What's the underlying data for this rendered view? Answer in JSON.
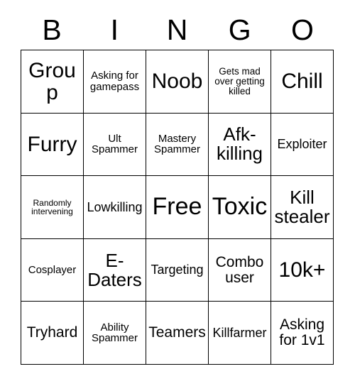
{
  "header": {
    "letters": [
      "B",
      "I",
      "N",
      "G",
      "O"
    ]
  },
  "grid": {
    "rows": [
      [
        {
          "text": "Group",
          "size": "fs-xl"
        },
        {
          "text": "Asking for gamepass",
          "size": "fs-xs"
        },
        {
          "text": "Noob",
          "size": "fs-xl"
        },
        {
          "text": "Gets mad over getting killed",
          "size": "fs-xxs"
        },
        {
          "text": "Chill",
          "size": "fs-xl"
        }
      ],
      [
        {
          "text": "Furry",
          "size": "fs-xl"
        },
        {
          "text": "Ult Spammer",
          "size": "fs-xs"
        },
        {
          "text": "Mastery Spammer",
          "size": "fs-xs"
        },
        {
          "text": "Afk-killing",
          "size": "fs-lg"
        },
        {
          "text": "Exploiter",
          "size": "fs-sm"
        }
      ],
      [
        {
          "text": "Randomly intervening",
          "size": "fs-tiny"
        },
        {
          "text": "Lowkilling",
          "size": "fs-sm"
        },
        {
          "text": "Free",
          "size": "fs-xxl"
        },
        {
          "text": "Toxic",
          "size": "fs-xxl"
        },
        {
          "text": "Kill stealer",
          "size": "fs-lg"
        }
      ],
      [
        {
          "text": "Cosplayer",
          "size": "fs-xs"
        },
        {
          "text": "E-Daters",
          "size": "fs-lg"
        },
        {
          "text": "Targeting",
          "size": "fs-sm"
        },
        {
          "text": "Combo user",
          "size": "fs-md"
        },
        {
          "text": "10k+",
          "size": "fs-xl"
        }
      ],
      [
        {
          "text": "Tryhard",
          "size": "fs-md"
        },
        {
          "text": "Ability Spammer",
          "size": "fs-xs"
        },
        {
          "text": "Teamers",
          "size": "fs-md"
        },
        {
          "text": "Killfarmer",
          "size": "fs-sm"
        },
        {
          "text": "Asking for 1v1",
          "size": "fs-md"
        }
      ]
    ]
  },
  "colors": {
    "background": "#ffffff",
    "text": "#000000",
    "border": "#000000"
  }
}
